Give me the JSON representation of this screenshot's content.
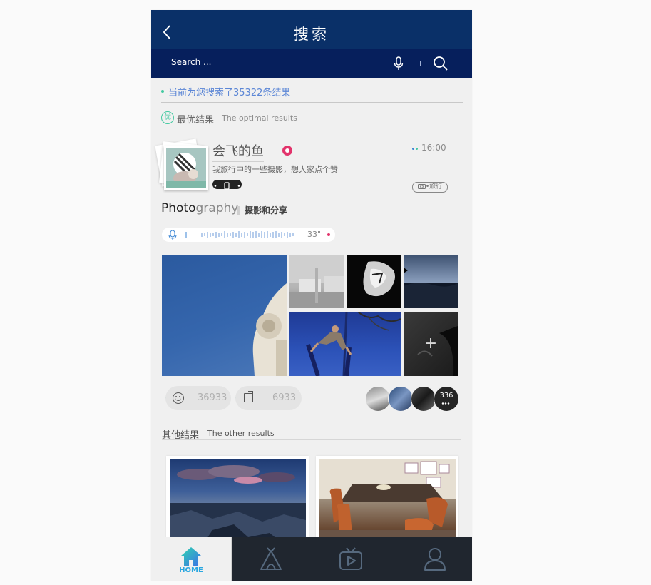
{
  "header": {
    "title": "搜索"
  },
  "search": {
    "placeholder": "Search ..."
  },
  "results": {
    "count_text": "当前为您搜索了35322条结果"
  },
  "optimal": {
    "icon_char": "优",
    "label_zh": "最优结果",
    "label_en": "The optimal results"
  },
  "post": {
    "username": "会飞的鱼",
    "time": "16:00",
    "bio": "我旅行中的一些摄影，想大家点个赞",
    "category": "旅行",
    "title_dark": "Photo",
    "title_light": "graphy",
    "subtitle": "摄影和分享",
    "voice_duration": "33\"",
    "like_count": "36933",
    "share_count": "6933",
    "viewer_count": "336"
  },
  "other": {
    "label_zh": "其他结果",
    "label_en": "The other results"
  },
  "tabs": {
    "home_label": "HOME"
  },
  "colors": {
    "header": "#0a3068",
    "search_bar": "#061f5c",
    "accent_green": "#43c9a0",
    "accent_blue": "#5b86d6",
    "badge_pink": "#e2336b",
    "tab_bar": "#20262f",
    "home_active": "#2aa7e0"
  },
  "icons": [
    "back-icon",
    "mic-icon",
    "search-icon",
    "optimal-badge-icon",
    "verified-badge-icon",
    "phone-icon",
    "camera-icon",
    "smiley-icon",
    "share-icon",
    "plus-icon",
    "home-icon",
    "camp-icon",
    "tv-icon",
    "user-icon"
  ]
}
